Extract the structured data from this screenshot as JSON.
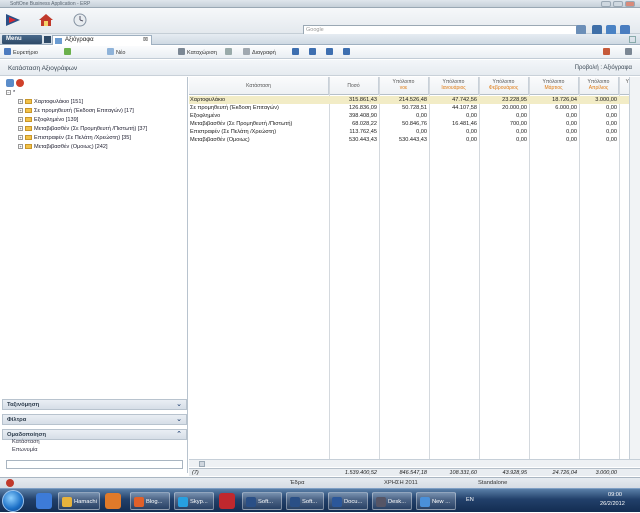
{
  "window": {
    "title": "SoftOne Business Application - ERP"
  },
  "topbar": {
    "search_placeholder": "Google"
  },
  "menu": {
    "menu_label": "Menu",
    "doc_tab": "Αξιόγραφα"
  },
  "toolbar": {
    "search_label": "Ευρετήριο",
    "new_label": "Νέο",
    "save_label": "Καταχώριση",
    "delete_label": "Διαγραφή"
  },
  "page": {
    "title": "Κατάσταση Αξιογράφων",
    "view_label": "Προβολή : Αξιόγραφα"
  },
  "tree": {
    "root": "*",
    "items": [
      {
        "label": "Χαρτοφυλάκιο [151]"
      },
      {
        "label": "Σε προμηθευτή (Έκδοση Επιταγών) [17]"
      },
      {
        "label": "Εξοφλημένο [139]"
      },
      {
        "label": "Μεταβιβασθέν (Σε Προμηθευτή /Πιστωτή) [37]"
      },
      {
        "label": "Επιστραφέν (Σε Πελάτη /Χρεώστη) [35]"
      },
      {
        "label": "Μεταβιβασθέν (Ομοιως) [242]"
      }
    ]
  },
  "sections": {
    "sort": "Ταξινόμηση",
    "filter": "Φίλτρα",
    "group": "Ομαδοποίηση",
    "group_items": [
      "Κατάσταση",
      "Επωνυμία"
    ]
  },
  "grid": {
    "columns": [
      {
        "l1": "Κατάσταση",
        "l2": ""
      },
      {
        "l1": "Ποσό",
        "l2": ""
      },
      {
        "l1": "Υπόλοιπο",
        "l2": "νοε"
      },
      {
        "l1": "Υπόλοιπο",
        "l2": "Ιανουάριος"
      },
      {
        "l1": "Υπόλοιπο",
        "l2": "Φεβρουάριος"
      },
      {
        "l1": "Υπόλοιπο",
        "l2": "Μάρτιος"
      },
      {
        "l1": "Υπόλοιπο",
        "l2": "Απρίλιος"
      },
      {
        "l1": "Υπ",
        "l2": ""
      }
    ],
    "rows": [
      {
        "status": "Χαρτοφυλάκιο",
        "amount": "315.861,43",
        "c1": "214.526,48",
        "c2": "47.742,56",
        "c3": "23.228,95",
        "c4": "18.726,04",
        "c5": "3.000,00"
      },
      {
        "status": "Σε προμηθευτή (Έκδοση Επιταγών)",
        "amount": "126.836,09",
        "c1": "50.728,51",
        "c2": "44.107,58",
        "c3": "20.000,00",
        "c4": "6.000,00",
        "c5": "0,00"
      },
      {
        "status": "Εξοφλημένο",
        "amount": "398.408,90",
        "c1": "0,00",
        "c2": "0,00",
        "c3": "0,00",
        "c4": "0,00",
        "c5": "0,00"
      },
      {
        "status": "Μεταβιβασθέν (Σε Προμηθευτή /Πιστωτή)",
        "amount": "68.028,22",
        "c1": "50.846,76",
        "c2": "16.481,46",
        "c3": "700,00",
        "c4": "0,00",
        "c5": "0,00"
      },
      {
        "status": "Επιστραφέν (Σε Πελάτη /Χρεώστη)",
        "amount": "113.762,45",
        "c1": "0,00",
        "c2": "0,00",
        "c3": "0,00",
        "c4": "0,00",
        "c5": "0,00"
      },
      {
        "status": "Μεταβιβασθέν (Ομοιως)",
        "amount": "530.443,43",
        "c1": "530.443,43",
        "c2": "0,00",
        "c3": "0,00",
        "c4": "0,00",
        "c5": "0,00"
      }
    ],
    "totals": {
      "count": "(7)",
      "amount": "1.539.400,52",
      "c1": "846.547,18",
      "c2": "108.331,60",
      "c3": "43.928,95",
      "c4": "24.726,04",
      "c5": "3.000,00"
    }
  },
  "statusbar": {
    "company": "Έδρα",
    "year": "ΧΡΗΣΗ 2011",
    "mode": "Standalone"
  },
  "taskbar": {
    "items": [
      {
        "label": "Hamachi"
      },
      {
        "label": "Blog..."
      },
      {
        "label": "Skyp..."
      },
      {
        "label": "Soft..."
      },
      {
        "label": "Soft..."
      },
      {
        "label": "Docu..."
      },
      {
        "label": "Desk..."
      },
      {
        "label": "New ..."
      }
    ],
    "lang": "EN",
    "time": "09:00",
    "date": "26/2/2012"
  },
  "colors": {
    "accent": "#e07a10",
    "selected_row": "#f2ecc6",
    "taskbar": "#1d3a63"
  }
}
